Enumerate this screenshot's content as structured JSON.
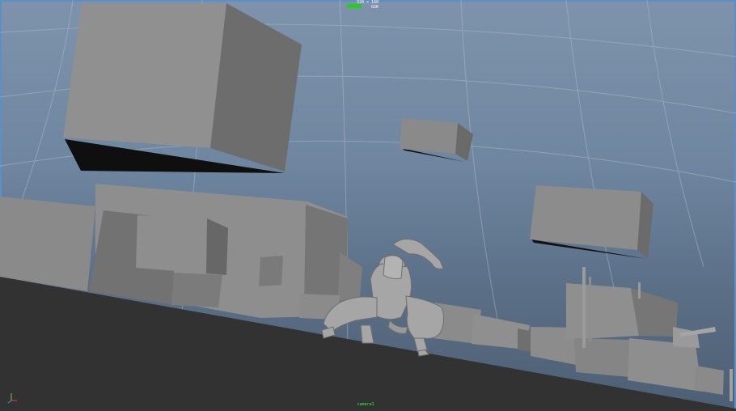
{
  "viewport": {
    "name": "maya-viewport",
    "hud": {
      "resolution_label": "320 × 160",
      "resolution_sub": "GSK"
    },
    "camera_label": "camera1"
  },
  "colors": {
    "sky_top": "#7e93ab",
    "sky_bottom": "#4d5f74",
    "ground": "#323232",
    "cube_light": "#8e8e8e",
    "cube_dark": "#6b6b6b",
    "shadow": "#111111",
    "hud_green": "#1fd11f",
    "grid": "#a7b5c7"
  }
}
